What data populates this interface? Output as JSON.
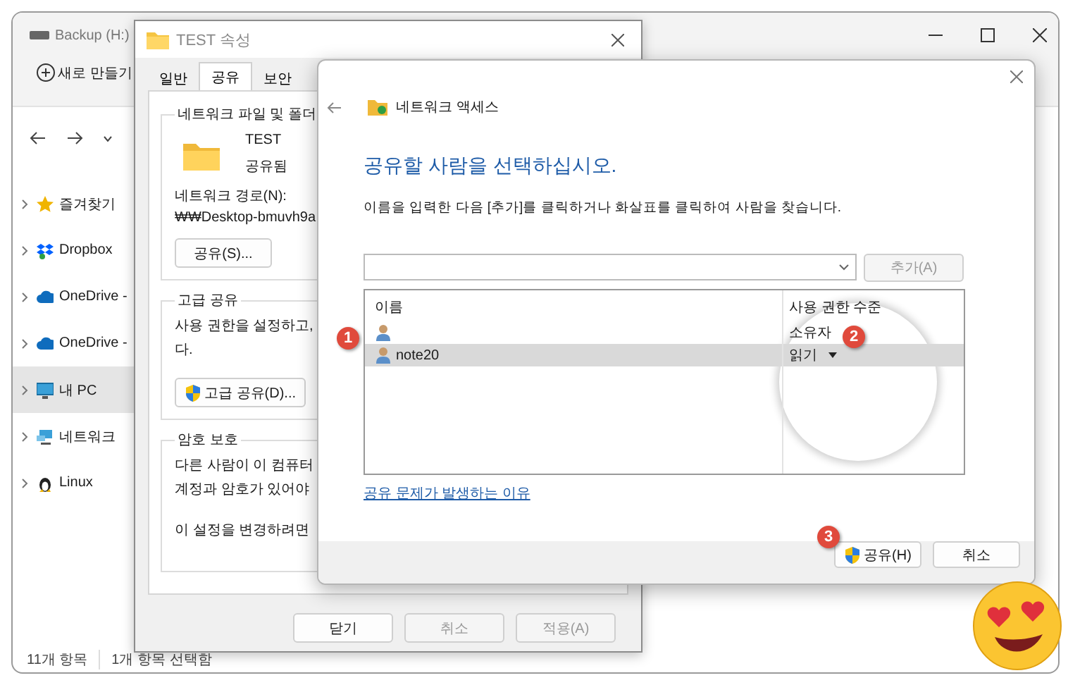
{
  "explorer": {
    "title": "Backup (H:)",
    "new_button": "새로 만들기",
    "sidebar": {
      "items": [
        {
          "label": "즐겨찾기",
          "kind": "star",
          "selected": false
        },
        {
          "label": "Dropbox",
          "kind": "dropbox",
          "selected": false
        },
        {
          "label": "OneDrive -",
          "kind": "cloud",
          "selected": false
        },
        {
          "label": "OneDrive -",
          "kind": "cloud",
          "selected": false
        },
        {
          "label": "내 PC",
          "kind": "pc",
          "selected": true
        },
        {
          "label": "네트워크",
          "kind": "network",
          "selected": false
        },
        {
          "label": "Linux",
          "kind": "linux",
          "selected": false
        }
      ]
    },
    "status_bar": [
      "11개 항목",
      "1개 항목 선택함"
    ]
  },
  "properties": {
    "title": "TEST 속성",
    "tabs": [
      {
        "label": "일반",
        "selected": false
      },
      {
        "label": "공유",
        "selected": true
      },
      {
        "label": "보안",
        "selected": false
      }
    ],
    "network_group": {
      "title": "네트워크 파일 및 폴더",
      "folder_name": "TEST",
      "folder_state": "공유됨",
      "path_label": "네트워크 경로(N):",
      "path": "₩₩Desktop-bmuvh9a",
      "button": "공유(S)..."
    },
    "advanced_group": {
      "title": "고급 공유",
      "lines": [
        "사용 권한을 설정하고,",
        "다."
      ],
      "button": "고급 공유(D)..."
    },
    "password_group": {
      "title": "암호 보호",
      "lines": [
        "다른 사람이 이 컴퓨터",
        "계정과 암호가 있어야"
      ],
      "note": "이 설정을 변경하려면"
    },
    "buttons": [
      {
        "label": "닫기",
        "disabled": false
      },
      {
        "label": "취소",
        "disabled": true
      },
      {
        "label": "적용(A)",
        "disabled": true
      }
    ]
  },
  "access_dialog": {
    "title": "네트워크 액세스",
    "heading": "공유할 사람을 선택하십시오.",
    "instruction": "이름을 입력한 다음 [추가]를 클릭하거나 화살표를 클릭하여 사람을 찾습니다.",
    "add_button": {
      "label": "추가(A)",
      "disabled": true
    },
    "table": {
      "columns": [
        "이름",
        "사용 권한 수준"
      ],
      "rows": [
        {
          "permission": "소유자",
          "selected": false,
          "dropdown": false
        },
        {
          "name": "note20",
          "permission": "읽기",
          "selected": true,
          "dropdown": true
        }
      ]
    },
    "help_link": "공유 문제가 발생하는 이유",
    "buttons": [
      {
        "label": "공유(H)",
        "shield": true
      },
      {
        "label": "취소",
        "shield": false
      }
    ]
  },
  "markers": [
    {
      "label": "1"
    },
    {
      "label": "2"
    },
    {
      "label": "3"
    }
  ]
}
